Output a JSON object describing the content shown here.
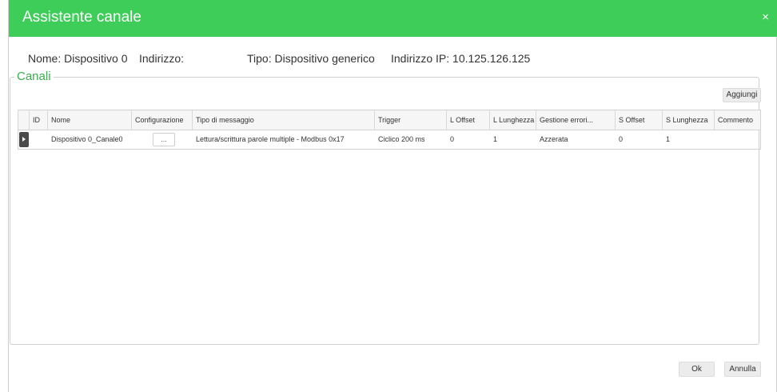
{
  "dialog": {
    "title": "Assistente canale",
    "close_glyph": "×"
  },
  "info": {
    "nome": "Nome: Dispositivo 0",
    "indirizzo": "Indirizzo:",
    "tipo": "Tipo: Dispositivo generico",
    "ip": "Indirizzo IP: 10.125.126.125"
  },
  "group": {
    "legend": "Canali",
    "add_label": "Aggiungi"
  },
  "table": {
    "columns": [
      "ID",
      "Nome",
      "Configurazione",
      "Tipo di messaggio",
      "Trigger",
      "L Offset",
      "L Lunghezza",
      "Gestione errori...",
      "S Offset",
      "S Lunghezza",
      "Commento"
    ],
    "rows": [
      {
        "id": "",
        "nome": "Dispositivo 0_Canale0",
        "configurazione": "...",
        "tipo": "Lettura/scrittura parole multiple - Modbus 0x17",
        "trigger": "Ciclico 200 ms",
        "l_offset": "0",
        "l_lunghezza": "1",
        "gestione": "Azzerata",
        "s_offset": "0",
        "s_lunghezza": "1",
        "commento": ""
      }
    ]
  },
  "footer": {
    "ok_label": "Ok",
    "cancel_label": "Annulla"
  },
  "colors": {
    "accent": "#3dcd58",
    "legend": "#3dab4f"
  },
  "icons": {
    "close": "close-icon",
    "row_selector": "row-selector-arrow-icon"
  }
}
